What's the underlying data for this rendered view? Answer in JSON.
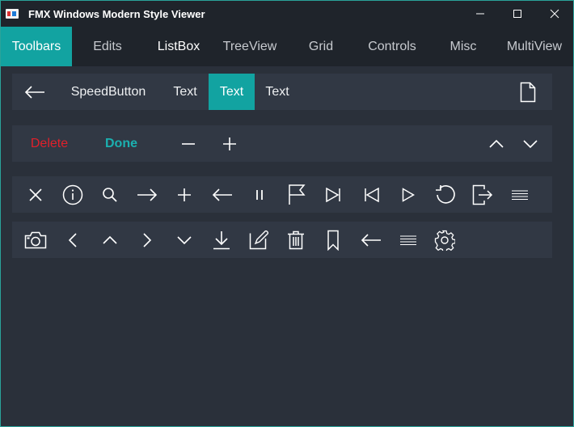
{
  "window": {
    "title": "FMX Windows Modern Style Viewer",
    "accent": "#12a3a1",
    "controls": [
      "minimize-icon",
      "maximize-icon",
      "close-icon"
    ]
  },
  "tabs": [
    {
      "label": "Toolbars",
      "active": true
    },
    {
      "label": "Edits",
      "active": false
    },
    {
      "label": "ListBox",
      "active": false
    },
    {
      "label": "TreeView",
      "active": false
    },
    {
      "label": "Grid",
      "active": false
    },
    {
      "label": "Controls",
      "active": false
    },
    {
      "label": "Misc",
      "active": false
    },
    {
      "label": "MultiView",
      "active": false
    }
  ],
  "toolbar1": {
    "back_icon": "arrow-left-icon",
    "speed_button": "SpeedButton",
    "text_buttons": [
      "Text",
      "Text",
      "Text"
    ],
    "toggled_index": 1,
    "right_icon": "document-icon"
  },
  "toolbar2": {
    "delete_label": "Delete",
    "delete_color": "#e0202a",
    "done_label": "Done",
    "done_color": "#1bb0b0",
    "icons": [
      "minus-icon",
      "plus-icon",
      "chevron-up-icon",
      "chevron-down-icon"
    ]
  },
  "toolbar3": {
    "icons": [
      "close-icon",
      "info-icon",
      "search-icon",
      "arrow-right-icon",
      "plus-icon",
      "arrow-left-icon",
      "pause-icon",
      "flag-icon",
      "skip-next-icon",
      "skip-previous-icon",
      "play-icon",
      "refresh-icon",
      "exit-icon",
      "menu-icon"
    ]
  },
  "toolbar4": {
    "icons": [
      "camera-icon",
      "chevron-left-icon",
      "chevron-up-icon",
      "chevron-right-icon",
      "chevron-down-icon",
      "download-icon",
      "edit-icon",
      "trash-icon",
      "bookmark-icon",
      "arrow-left-icon",
      "menu-icon",
      "gear-icon"
    ]
  }
}
